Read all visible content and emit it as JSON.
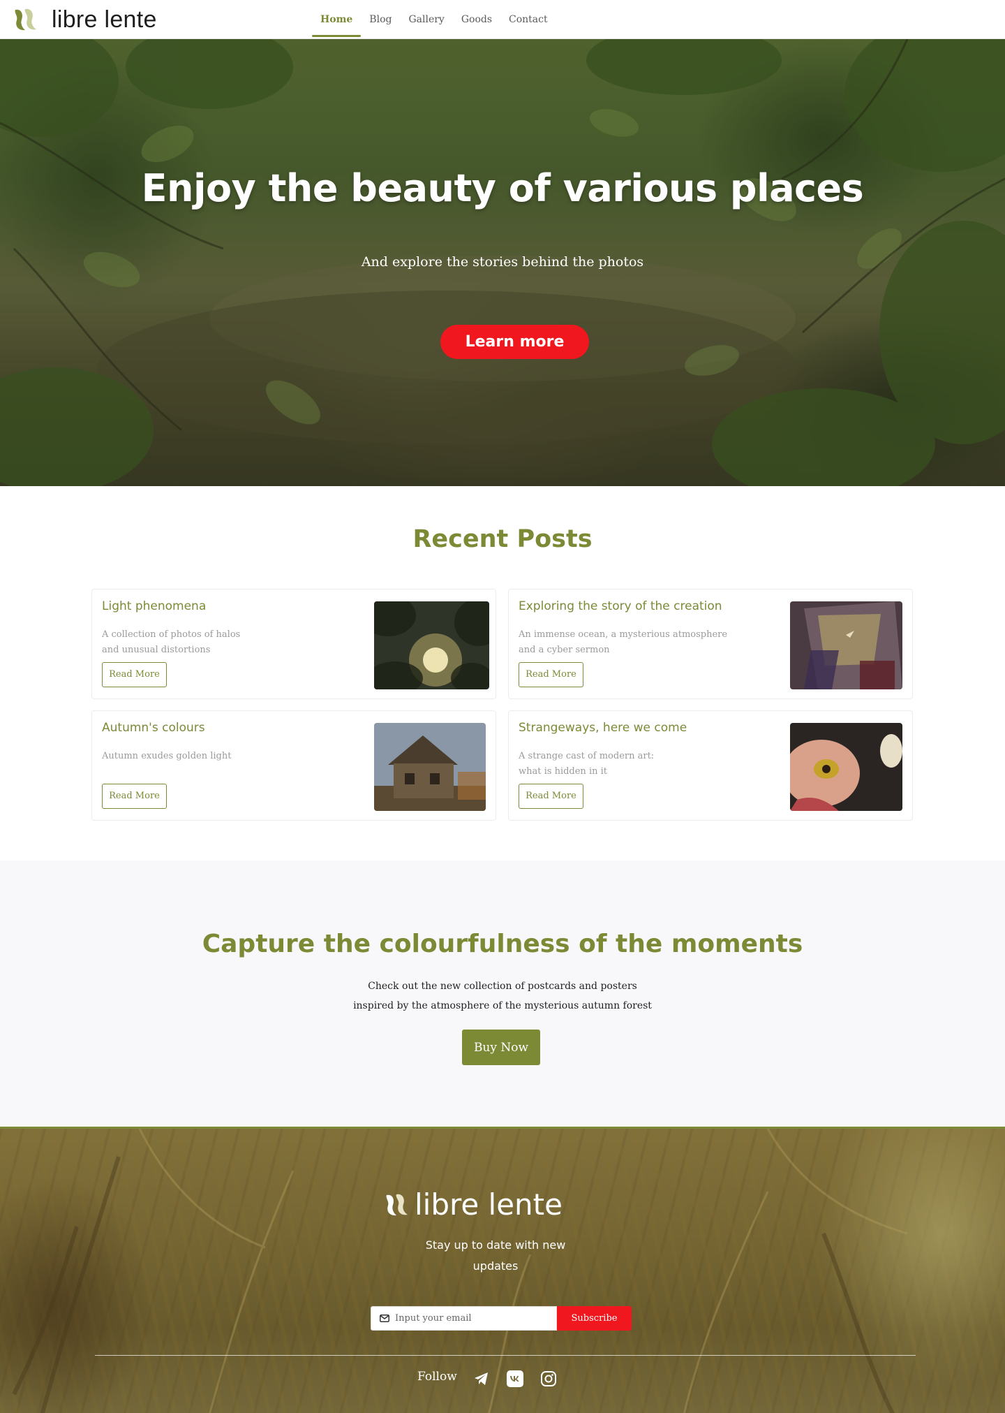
{
  "header": {
    "logo_text": "libre lente",
    "nav": [
      {
        "label": "Home",
        "active": true
      },
      {
        "label": "Blog"
      },
      {
        "label": "Gallery"
      },
      {
        "label": "Goods"
      },
      {
        "label": "Contact"
      }
    ]
  },
  "hero": {
    "title": "Enjoy the beauty of various places",
    "subtitle": "And explore the stories behind the photos",
    "button": "Learn more"
  },
  "recent": {
    "title": "Recent Posts",
    "posts": [
      {
        "title": "Light phenomena",
        "desc_line1": "A collection of photos of halos",
        "desc_line2": "and unusual distortions",
        "button": "Read More"
      },
      {
        "title": "Exploring the story of the creation",
        "desc_line1": "An immense ocean, a mysterious atmosphere",
        "desc_line2": "and a cyber sermon",
        "button": "Read More"
      },
      {
        "title": "Autumn's colours",
        "desc_line1": "Autumn exudes golden light",
        "desc_line2": "",
        "button": "Read More"
      },
      {
        "title": "Strangeways, here we come",
        "desc_line1": "A strange cast of modern art:",
        "desc_line2": "what is hidden in it",
        "button": "Read More"
      }
    ]
  },
  "promo": {
    "title": "Capture the colourfulness of the moments",
    "line1": "Check out the new collection of postcards and posters",
    "line2": "inspired by the atmosphere of the mysterious autumn forest",
    "button": "Buy Now"
  },
  "footer": {
    "logo_text": "libre lente",
    "tagline_line1": "Stay up to date with new",
    "tagline_line2": "updates",
    "email_placeholder": "Input your email",
    "subscribe": "Subscribe",
    "follow": "Follow",
    "social_icons": [
      "telegram-icon",
      "vk-icon",
      "instagram-icon"
    ]
  },
  "colors": {
    "accent": "#7d8a35",
    "cta": "#f0171e"
  }
}
